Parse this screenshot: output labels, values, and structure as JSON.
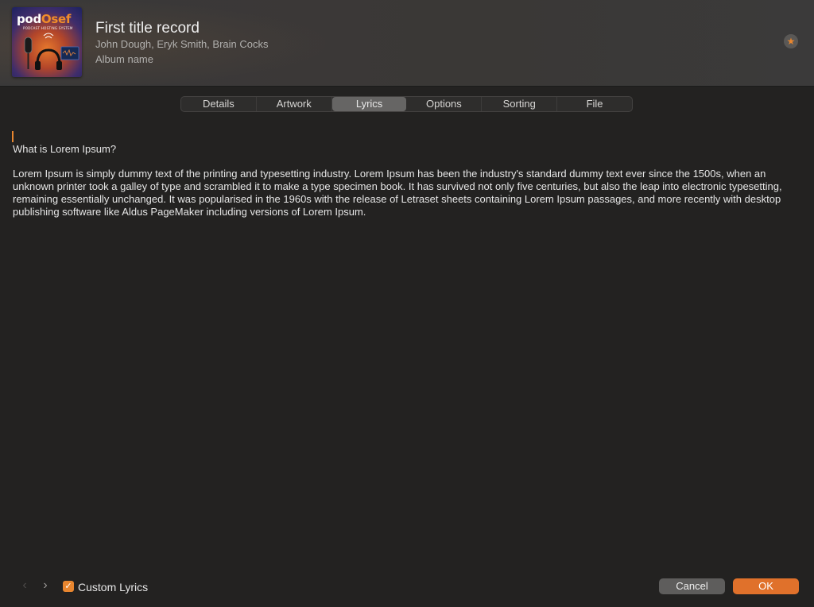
{
  "track": {
    "title": "First title record",
    "artist": "John Dough, Eryk Smith, Brain Cocks",
    "album": "Album name",
    "artwork_logo_main": "pod",
    "artwork_logo_accent": "Osef",
    "artwork_tagline": "PODCAST HOSTING SYSTEM"
  },
  "tabs": [
    {
      "label": "Details"
    },
    {
      "label": "Artwork"
    },
    {
      "label": "Lyrics"
    },
    {
      "label": "Options"
    },
    {
      "label": "Sorting"
    },
    {
      "label": "File"
    }
  ],
  "active_tab": "Lyrics",
  "lyrics": {
    "heading": "What is Lorem Ipsum?",
    "body": "Lorem Ipsum is simply dummy text of the printing and typesetting industry. Lorem Ipsum has been the industry's standard dummy text ever since the 1500s, when an unknown printer took a galley of type and scrambled it to make a type specimen book. It has survived not only five centuries, but also the leap into electronic typesetting, remaining essentially unchanged. It was popularised in the 1960s with the release of Letraset sheets containing Lorem Ipsum passages, and more recently with desktop publishing software like Aldus PageMaker including versions of Lorem Ipsum."
  },
  "footer": {
    "prev_icon": "‹",
    "next_icon": "›",
    "custom_lyrics_label": "Custom Lyrics",
    "custom_lyrics_checked": true,
    "cancel_label": "Cancel",
    "ok_label": "OK"
  },
  "icons": {
    "star": "star-icon",
    "checkmark": "checkmark-icon",
    "prev": "chevron-left-icon",
    "next": "chevron-right-icon"
  },
  "colors": {
    "accent": "#e8862f",
    "ok_button": "#e0712b",
    "background": "#232221",
    "header": "#3a3939"
  }
}
